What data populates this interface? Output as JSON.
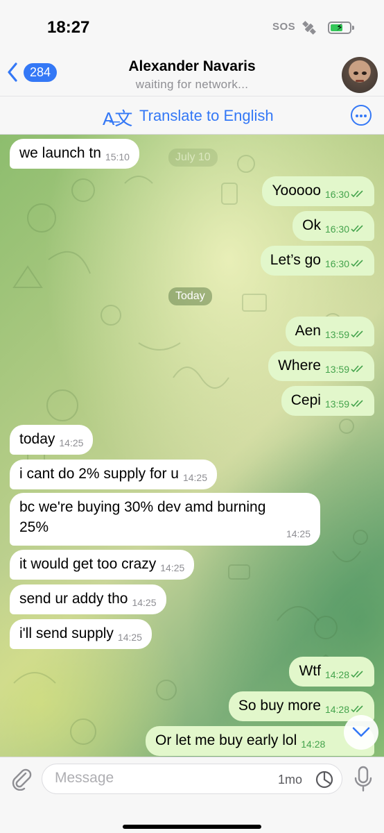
{
  "status_bar": {
    "time": "18:27",
    "sos": "SOS"
  },
  "header": {
    "back_count": "284",
    "contact_name": "Alexander Navaris",
    "status": "waiting for network..."
  },
  "translate_bar": {
    "icon": "translate-icon",
    "label": "Translate to English"
  },
  "date_pills": {
    "july": "July 10",
    "today": "Today"
  },
  "messages": [
    {
      "dir": "in",
      "text": "we launch tn",
      "time": "15:10"
    },
    {
      "dir": "out",
      "text": "Yooooo",
      "time": "16:30"
    },
    {
      "dir": "out",
      "text": "Ok",
      "time": "16:30"
    },
    {
      "dir": "out",
      "text": "Let’s go",
      "time": "16:30"
    },
    {
      "dir": "out",
      "text": "Aen",
      "time": "13:59"
    },
    {
      "dir": "out",
      "text": "Where",
      "time": "13:59"
    },
    {
      "dir": "out",
      "text": "Cepi",
      "time": "13:59"
    },
    {
      "dir": "in",
      "text": "today",
      "time": "14:25"
    },
    {
      "dir": "in",
      "text": "i cant do 2% supply for u",
      "time": "14:25"
    },
    {
      "dir": "in",
      "text_line1": "bc we're buying 30% dev amd burning",
      "text_line2": "25%",
      "time": "14:25"
    },
    {
      "dir": "in",
      "text": "it would get too crazy",
      "time": "14:25"
    },
    {
      "dir": "in",
      "text": "send ur addy tho",
      "time": "14:25"
    },
    {
      "dir": "in",
      "text": "i'll send supply",
      "time": "14:25"
    },
    {
      "dir": "out",
      "text": "Wtf",
      "time": "14:28"
    },
    {
      "dir": "out",
      "text": "So buy more",
      "time": "14:28"
    },
    {
      "dir": "out",
      "text": "Or let me buy early lol",
      "time": "14:28"
    }
  ],
  "input": {
    "placeholder": "Message",
    "timer": "1mo"
  },
  "colors": {
    "accent": "#3478f6",
    "outgoing": "#e2f7cb",
    "incoming": "#ffffff",
    "read_ticks": "#44a34c"
  }
}
